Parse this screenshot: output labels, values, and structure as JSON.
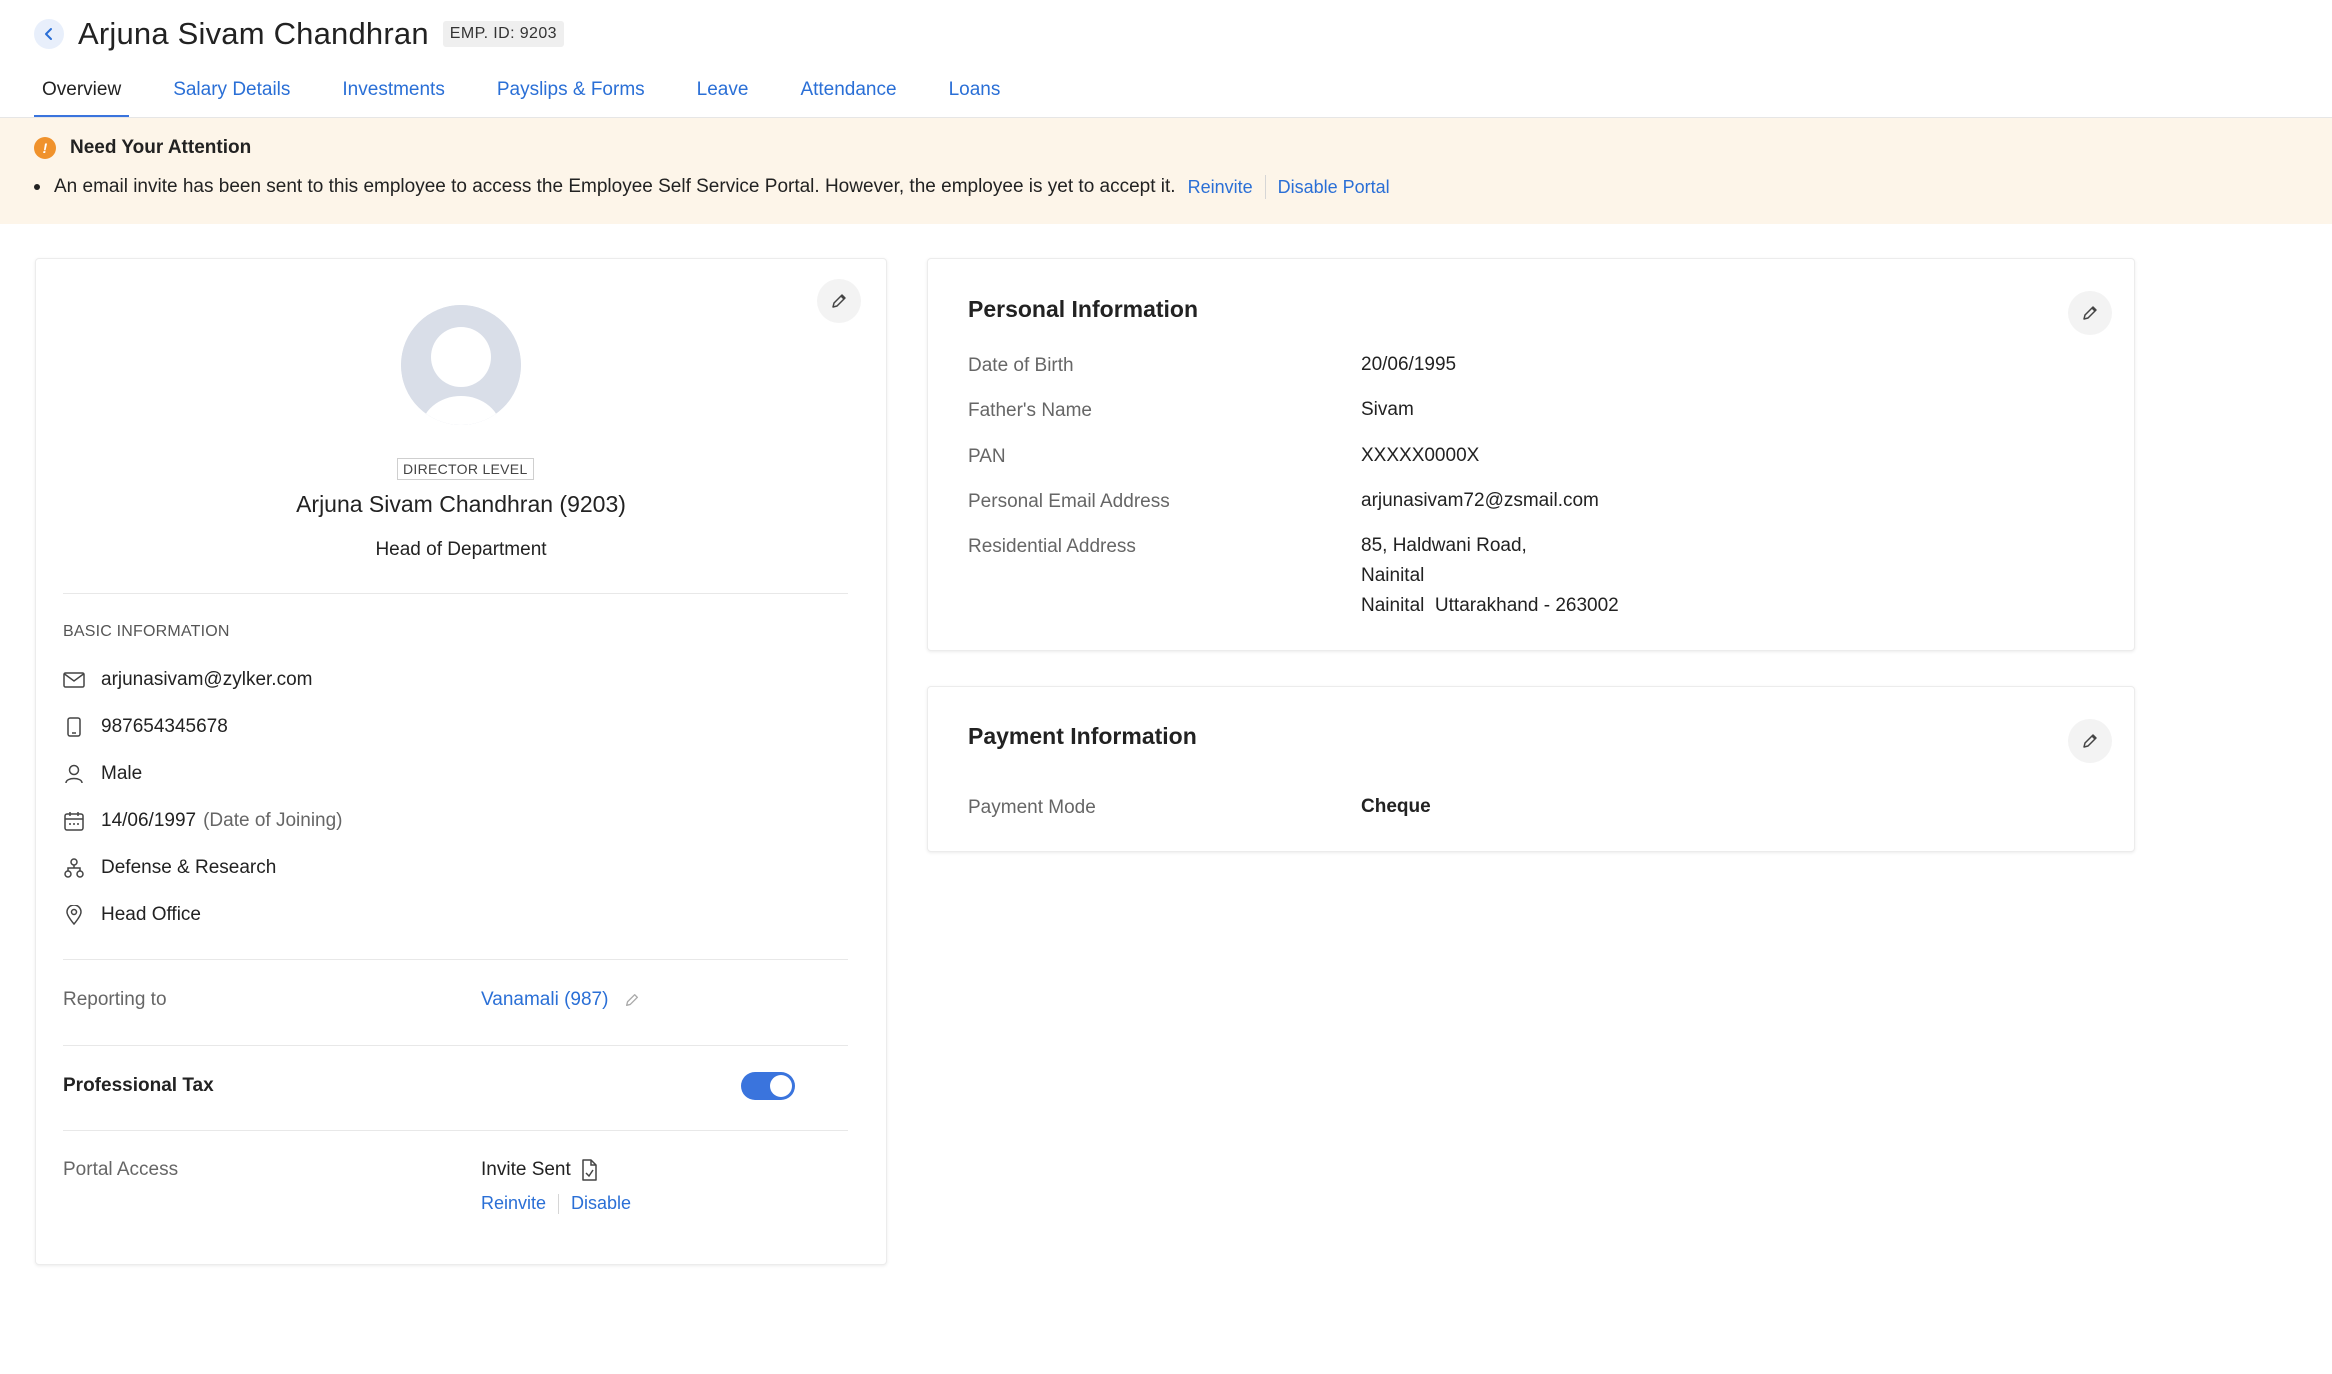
{
  "header": {
    "title": "Arjuna Sivam Chandhran",
    "emp_id": "EMP. ID: 9203"
  },
  "tabs": [
    {
      "label": "Overview",
      "active": true
    },
    {
      "label": "Salary Details",
      "active": false
    },
    {
      "label": "Investments",
      "active": false
    },
    {
      "label": "Payslips & Forms",
      "active": false
    },
    {
      "label": "Leave",
      "active": false
    },
    {
      "label": "Attendance",
      "active": false
    },
    {
      "label": "Loans",
      "active": false
    }
  ],
  "banner": {
    "title": "Need Your Attention",
    "message": "An email invite has been sent to this employee to access the Employee Self Service Portal. However, the employee is yet to accept it.",
    "reinvite": "Reinvite",
    "disable_portal": "Disable Portal"
  },
  "profile": {
    "level": "DIRECTOR LEVEL",
    "name": "Arjuna Sivam Chandhran (9203)",
    "role": "Head of Department",
    "basic_info_label": "BASIC INFORMATION",
    "email": "arjunasivam@zylker.com",
    "phone": "987654345678",
    "gender": "Male",
    "joining_date": "14/06/1997",
    "joining_label": "(Date of Joining)",
    "department": "Defense & Research",
    "location": "Head Office",
    "reporting_label": "Reporting to",
    "reporting_value": "Vanamali (987)",
    "professional_tax_label": "Professional Tax",
    "professional_tax_enabled": true,
    "portal_label": "Portal Access",
    "portal_status": "Invite Sent",
    "portal_reinvite": "Reinvite",
    "portal_disable": "Disable"
  },
  "personal": {
    "title": "Personal Information",
    "dob_label": "Date of Birth",
    "dob": "20/06/1995",
    "father_label": "Father's Name",
    "father": "Sivam",
    "pan_label": "PAN",
    "pan": "XXXXX0000X",
    "email_label": "Personal Email Address",
    "email": "arjunasivam72@zsmail.com",
    "address_label": "Residential Address",
    "address_line1": "85, Haldwani Road,",
    "address_line2": "Nainital",
    "address_line3": "Nainital  Uttarakhand - 263002"
  },
  "payment": {
    "title": "Payment Information",
    "mode_label": "Payment Mode",
    "mode": "Cheque"
  },
  "colors": {
    "accent": "#3a74dd",
    "link": "#2a6fd6",
    "banner_bg": "#fdf5e9",
    "warning": "#f0922c"
  }
}
